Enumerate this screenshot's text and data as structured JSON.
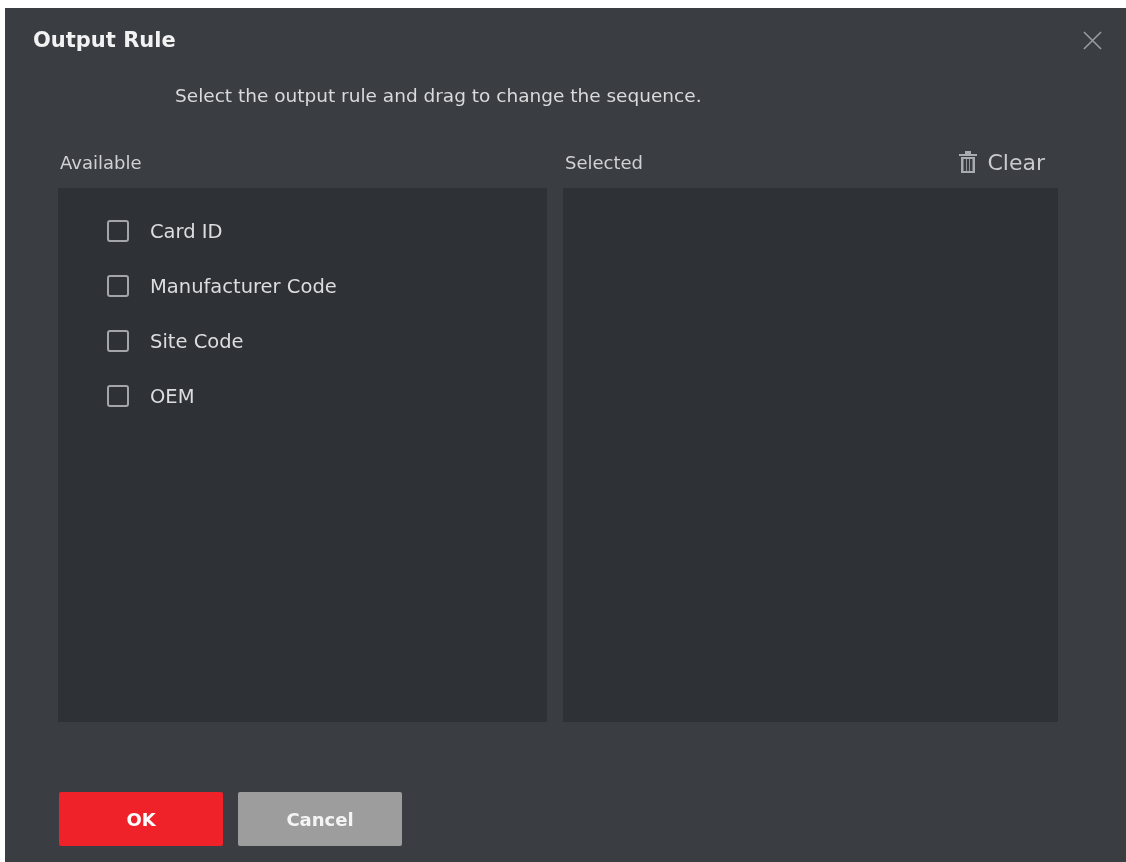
{
  "dialog": {
    "title": "Output Rule",
    "instruction": "Select the output rule and drag to change the sequence."
  },
  "available": {
    "label": "Available",
    "items": [
      {
        "label": "Card ID",
        "checked": false
      },
      {
        "label": "Manufacturer Code",
        "checked": false
      },
      {
        "label": "Site Code",
        "checked": false
      },
      {
        "label": "OEM",
        "checked": false
      }
    ]
  },
  "selected": {
    "label": "Selected",
    "clear_button": "Clear"
  },
  "buttons": [
    {
      "label": "OK",
      "kind": "primary"
    },
    {
      "label": "Cancel",
      "kind": "secondary"
    }
  ]
}
